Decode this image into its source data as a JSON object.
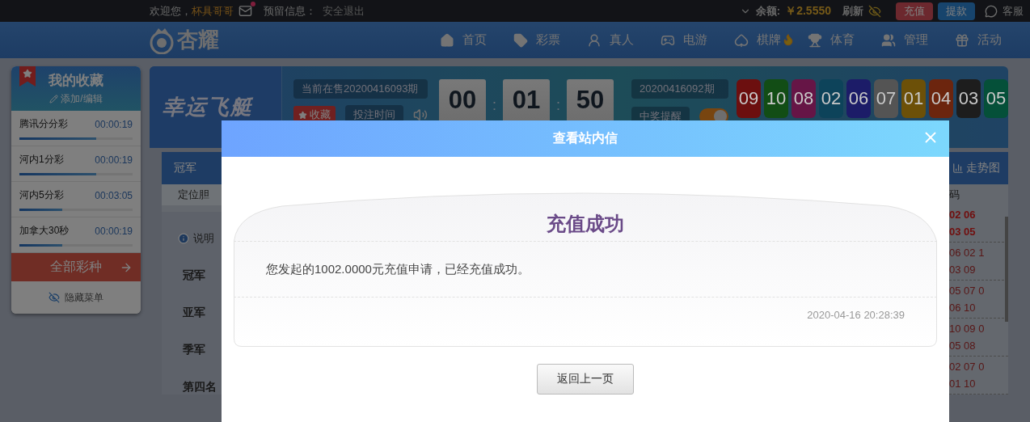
{
  "top_bar": {
    "greeting": "欢迎您，",
    "username": "杯具哥哥",
    "has_new_mail": true,
    "reserved_label": "预留信息：",
    "logout": "安全退出",
    "balance_label": "余额:",
    "balance": "￥2.5550",
    "refresh": "刷新",
    "recharge": "充值",
    "withdraw": "提款",
    "service": "客服"
  },
  "nav": {
    "logo": "杏耀",
    "items": [
      {
        "label": "首页",
        "kind": "home",
        "hot": false
      },
      {
        "label": "彩票",
        "kind": "tag",
        "hot": false
      },
      {
        "label": "真人",
        "kind": "person",
        "hot": false
      },
      {
        "label": "电游",
        "kind": "slot",
        "hot": false
      },
      {
        "label": "棋牌",
        "kind": "cards",
        "hot": true
      },
      {
        "label": "体育",
        "kind": "trophy",
        "hot": false
      },
      {
        "label": "管理",
        "kind": "users",
        "hot": false
      },
      {
        "label": "活动",
        "kind": "gift",
        "hot": false
      }
    ]
  },
  "sidebar": {
    "title": "我的收藏",
    "edit": "添加/编辑",
    "items": [
      {
        "name": "腾讯分分彩",
        "time": "00:00:19",
        "level": 0.68
      },
      {
        "name": "河内1分彩",
        "time": "00:00:19",
        "level": 0.68
      },
      {
        "name": "河内5分彩",
        "time": "00:03:05",
        "level": 0.38
      },
      {
        "name": "加拿大30秒",
        "time": "00:00:19",
        "level": 0.38
      }
    ],
    "all_button": "全部彩种",
    "hide_menu": "隐藏菜单"
  },
  "game": {
    "logo": "幸运飞艇",
    "current_period": "当前在售20200416093期",
    "favorite": "收藏",
    "bet_time": "投注时间",
    "countdown": [
      "00",
      "01",
      "50"
    ],
    "countdown_separator": ":",
    "last_period": "20200416092期",
    "win_alert": "中奖提醒",
    "win_alert_on": true,
    "balls": [
      {
        "number": "09",
        "color": "#6c0f0f"
      },
      {
        "number": "10",
        "color": "#124d15"
      },
      {
        "number": "08",
        "color": "#661546"
      },
      {
        "number": "02",
        "color": "#0d435a"
      },
      {
        "number": "06",
        "color": "#1c1c68"
      },
      {
        "number": "07",
        "color": "#545454"
      },
      {
        "number": "01",
        "color": "#6c5008"
      },
      {
        "number": "04",
        "color": "#6c250e"
      },
      {
        "number": "03",
        "color": "#1d1d1d"
      },
      {
        "number": "05",
        "color": "#055039"
      }
    ]
  },
  "bet_panel": {
    "tab": "冠军",
    "mode": "定位胆",
    "note": "说明",
    "positions": [
      "冠军",
      "亚军",
      "季军",
      "第四名"
    ]
  },
  "history": {
    "trend": "走势图",
    "column": "码",
    "rows": [
      {
        "lines": [
          "02 06",
          "03 05"
        ],
        "latest": true
      },
      {
        "lines": [
          "06 02 1",
          "03 09"
        ],
        "latest": false
      },
      {
        "lines": [
          "05 07 0",
          "06 10"
        ],
        "latest": false
      },
      {
        "lines": [
          "10 09 0",
          "05 08"
        ],
        "latest": false
      },
      {
        "lines": [
          "02 07 0",
          "01 10"
        ],
        "latest": false
      }
    ]
  },
  "modal": {
    "title": "查看站内信",
    "heading": "充值成功",
    "message": "您发起的1002.0000元充值申请，已经充值成功。",
    "date": "2020-04-16 20:28:39",
    "back": "返回上一页"
  }
}
